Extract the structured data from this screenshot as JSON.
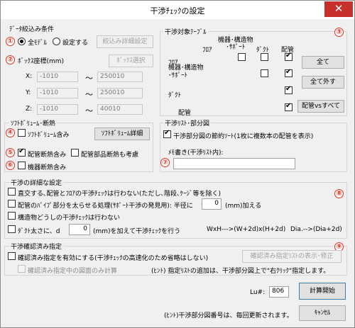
{
  "title": "干渉ﾁｪｯｸの設定",
  "close_glyph": "✕",
  "markers": [
    "①",
    "②",
    "③",
    "④",
    "⑤",
    "⑥",
    "⑦",
    "⑧",
    "⑨"
  ],
  "data_filter": {
    "label": "ﾃﾞｰﾀ絞込み条件",
    "all_models": "全ﾓﾃﾞﾙ",
    "set": "設定する",
    "detail_btn": "絞込み詳細設定"
  },
  "box": {
    "label": "ﾎﾞｯｸｽ座標(mm)",
    "select_btn": "ﾎﾞｯｸｽ選択",
    "rows": [
      {
        "axis": "X:",
        "min": "-1010",
        "max": "250010"
      },
      {
        "axis": "Y:",
        "min": "-1010",
        "max": "250010"
      },
      {
        "axis": "Z:",
        "min": "-1010",
        "max": "40010"
      }
    ],
    "tilde": "～"
  },
  "target": {
    "label": "干渉対象ﾃｰﾌﾞﾙ",
    "col_floor": "ﾌﾛｱ",
    "col_equip": "機器･構造物\n･ｻﾎﾟｰﾄ",
    "col_duct": "ﾀﾞｸﾄ",
    "col_pipe": "配管",
    "rows": [
      {
        "name": "ﾌﾛｱ",
        "checks": [
          false,
          false,
          false,
          true
        ]
      },
      {
        "name": "機器･構造物\n･ｻﾎﾟｰﾄ",
        "checks": [
          false,
          false,
          false,
          true
        ]
      },
      {
        "name": "ﾀﾞｸﾄ",
        "checks": [
          false,
          false,
          false,
          true
        ]
      },
      {
        "name": "配管",
        "checks": [
          false,
          false,
          false,
          true
        ]
      }
    ],
    "all_btn": "全て",
    "clear_btn": "全て外す",
    "pipe_all_btn": "配管vsすべて"
  },
  "softvol": {
    "label": "ｿﾌﾄﾎﾞﾘｭｰﾑ･断熱",
    "include": "ｿﾌﾄﾎﾞﾘｭｰﾑ含み",
    "detail_btn": "ｿﾌﾄﾎﾞﾘｭｰﾑ詳細",
    "pipe_insul": "配管断熱含み",
    "pipe_parts_insul": "配管部品断熱も考慮",
    "equip_insul": "機器断熱含み"
  },
  "list": {
    "label": "干渉ﾘｽﾄ･部分図",
    "save_sort": "干渉部分図の節約ｿｰﾄ(1枚に複数本の配管を表示)",
    "memo_label": "ﾒﾓ書き(干渉ﾘｽﾄ内):",
    "memo_value": ""
  },
  "detail": {
    "label": "干渉の詳細な設定",
    "opt1": "直交する､配管とﾌﾛｱの干渉ﾁｪｯｸは行わない(ただし､階段､ｹｰｼﾞ等を除く)",
    "opt2": "配管のﾊﾟｲﾌﾟ部分を太らせる処理(ｻﾎﾟｰﾄ干渉の発見用): 半径に",
    "opt2_value": "0",
    "opt2_unit": "(mm)加える",
    "opt3": "構造物どうしの干渉ﾁｪｯｸは行わない",
    "opt4a": "ﾀﾞｸﾄ太さに、d",
    "opt4_value": "0",
    "opt4b": "(mm)を加えて干渉ﾁｪｯｸを行う",
    "opt4_formula1": "WxH--->(W+2d)x(H+2d)",
    "opt4_formula2": "Dia.-->(Dia+2d)"
  },
  "confirm": {
    "label": "干渉確認済み指定",
    "enable": "確認済み指定を有効にする(干渉ﾁｪｯｸの高速化のため省略はしない)",
    "show_btn": "確認済み指定ﾘｽﾄの表示･修正",
    "only_calc": "確認済み指定中の図面のみ計算",
    "hint": "(ﾋﾝﾄ) 指定ﾘｽﾄの追加は、干渉部分図上で\"右ｸﾘｯｸ\"指定します。"
  },
  "footer": {
    "lu_label": "Lu#:",
    "lu_value": "806",
    "start_btn": "計算開始",
    "cancel_btn": "ｷｬﾝｾﾙ",
    "hint": "(ﾋﾝﾄ)干渉部分図番号は、毎回更新されます。"
  }
}
